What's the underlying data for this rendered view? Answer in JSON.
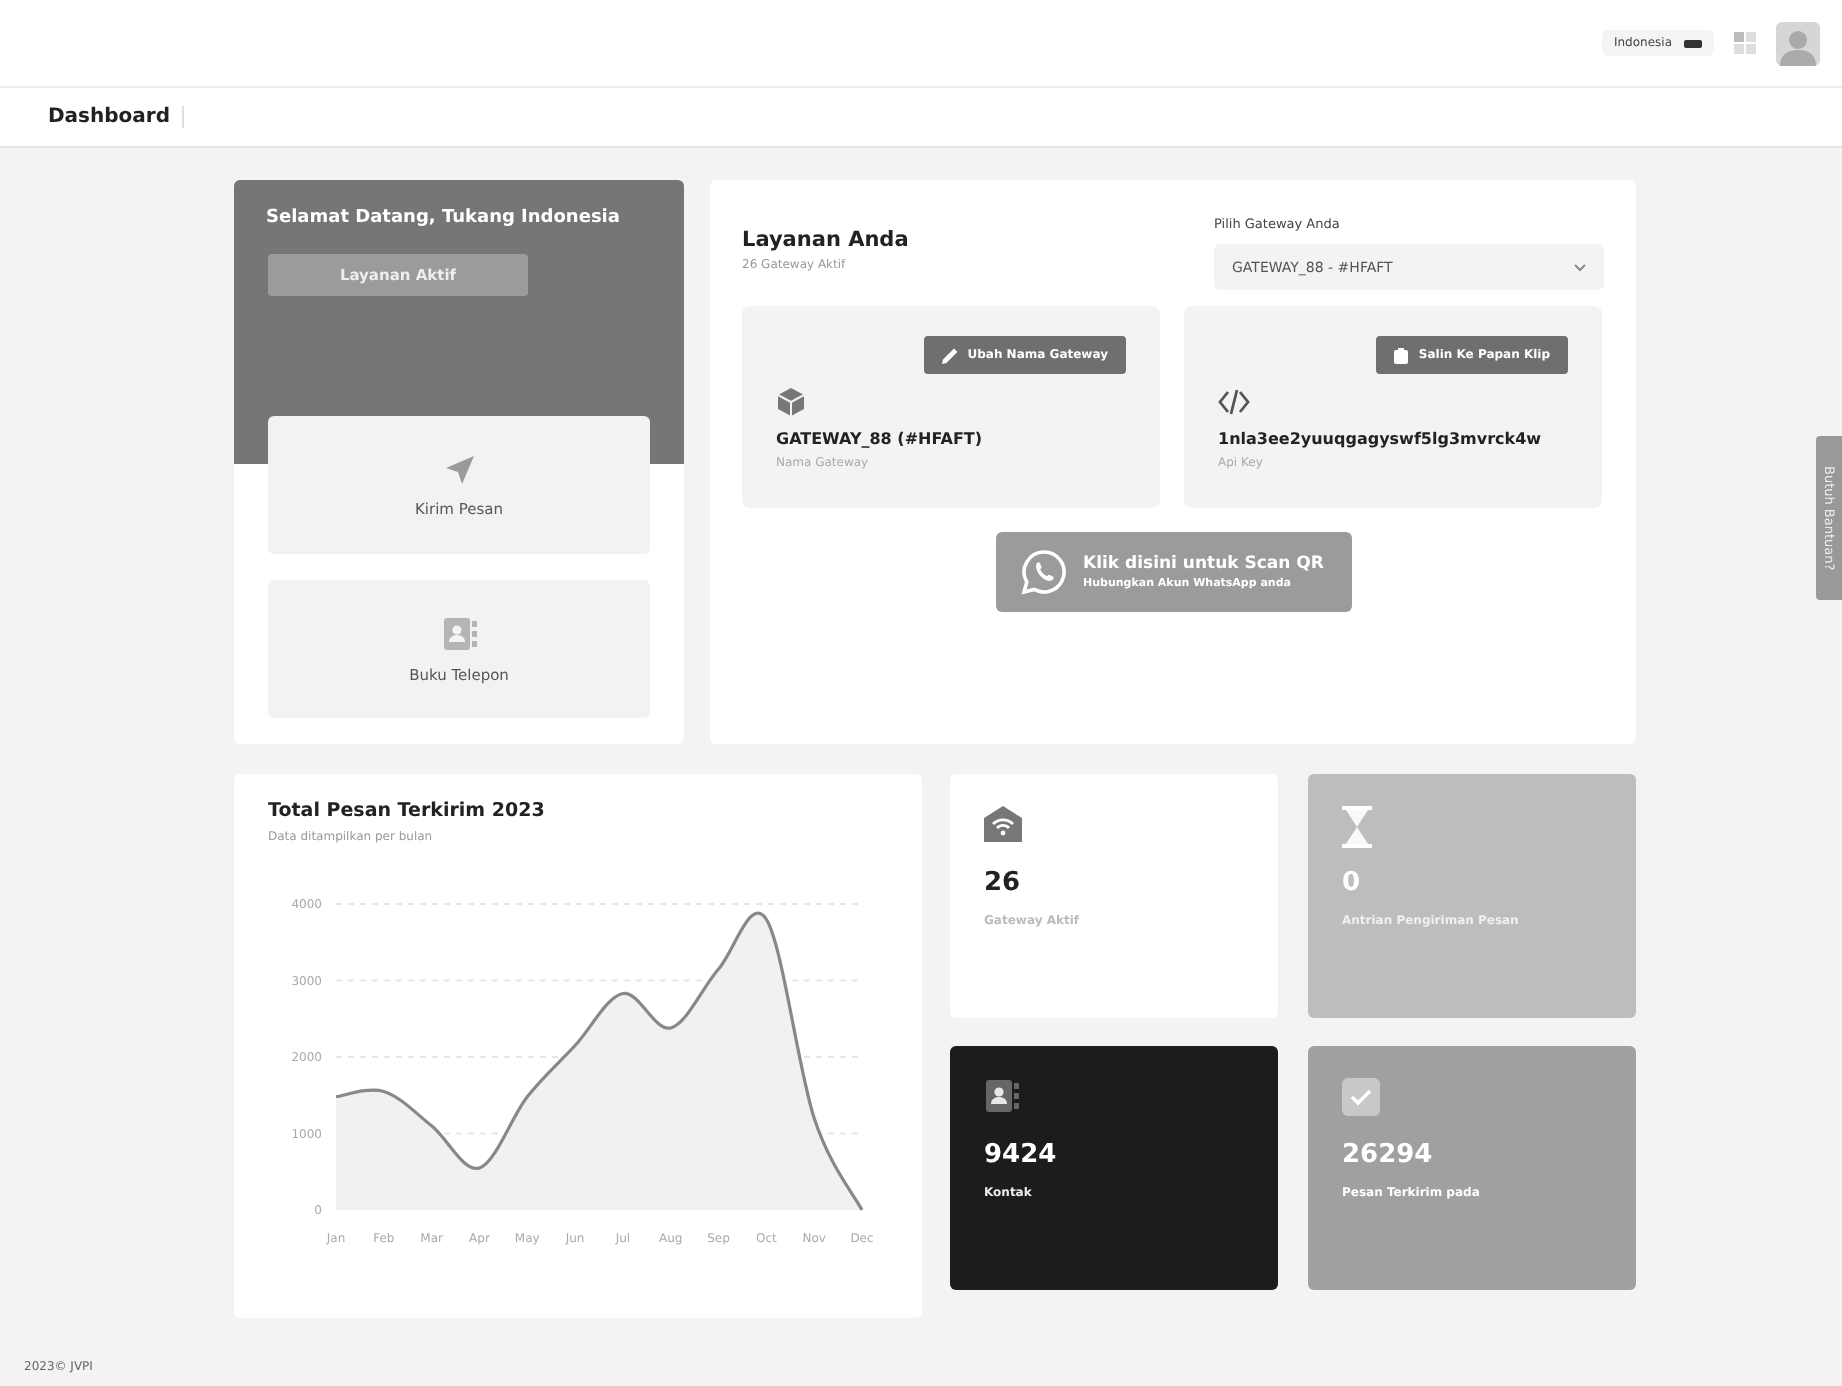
{
  "header": {
    "language": "Indonesia"
  },
  "breadcrumb": "Dashboard",
  "welcome": {
    "title": "Selamat Datang, Tukang Indonesia",
    "button": "Layanan Aktif",
    "shortcuts": [
      {
        "kind": "send",
        "label": "Kirim Pesan"
      },
      {
        "kind": "contacts",
        "label": "Buku Telepon"
      }
    ]
  },
  "service": {
    "title": "Layanan Anda",
    "subtitle": "26 Gateway Aktif",
    "gateway_label": "Pilih Gateway Anda",
    "gateway_value": "GATEWAY_88 - #HFAFT",
    "panels": [
      {
        "kind": "gateway",
        "button": "Ubah Nama Gateway",
        "value": "GATEWAY_88 (#HFAFT)",
        "caption": "Nama Gateway"
      },
      {
        "kind": "api",
        "button": "Salin Ke Papan Klip",
        "value": "1nla3ee2yuuqgagyswf5lg3mvrck4w",
        "caption": "Api Key"
      }
    ],
    "qr_button": {
      "title": "Klik disini untuk Scan QR",
      "subtitle": "Hubungkan Akun WhatsApp anda"
    }
  },
  "chart": {
    "title": "Total Pesan Terkirim 2023",
    "subtitle": "Data ditampilkan per bulan",
    "chart_data": {
      "type": "area",
      "categories": [
        "Jan",
        "Feb",
        "Mar",
        "Apr",
        "May",
        "Jun",
        "Jul",
        "Aug",
        "Sep",
        "Oct",
        "Nov",
        "Dec"
      ],
      "values": [
        1480,
        1550,
        1100,
        550,
        1480,
        2150,
        2830,
        2380,
        3150,
        3800,
        1200,
        0
      ],
      "ylim": [
        0,
        4000
      ],
      "yticks": [
        0,
        1000,
        2000,
        3000,
        4000
      ],
      "grid": true
    }
  },
  "stats": [
    {
      "kind": "gateway",
      "value": "26",
      "label": "Gateway Aktif"
    },
    {
      "kind": "queue",
      "value": "0",
      "label": "Antrian Pengiriman Pesan"
    },
    {
      "kind": "contacts",
      "value": "9424",
      "label": "Kontak"
    },
    {
      "kind": "sent",
      "value": "26294",
      "label": "Pesan Terkirim pada"
    }
  ],
  "help_tab": "Butuh Bantuan?",
  "footer": "2023© JVPI"
}
